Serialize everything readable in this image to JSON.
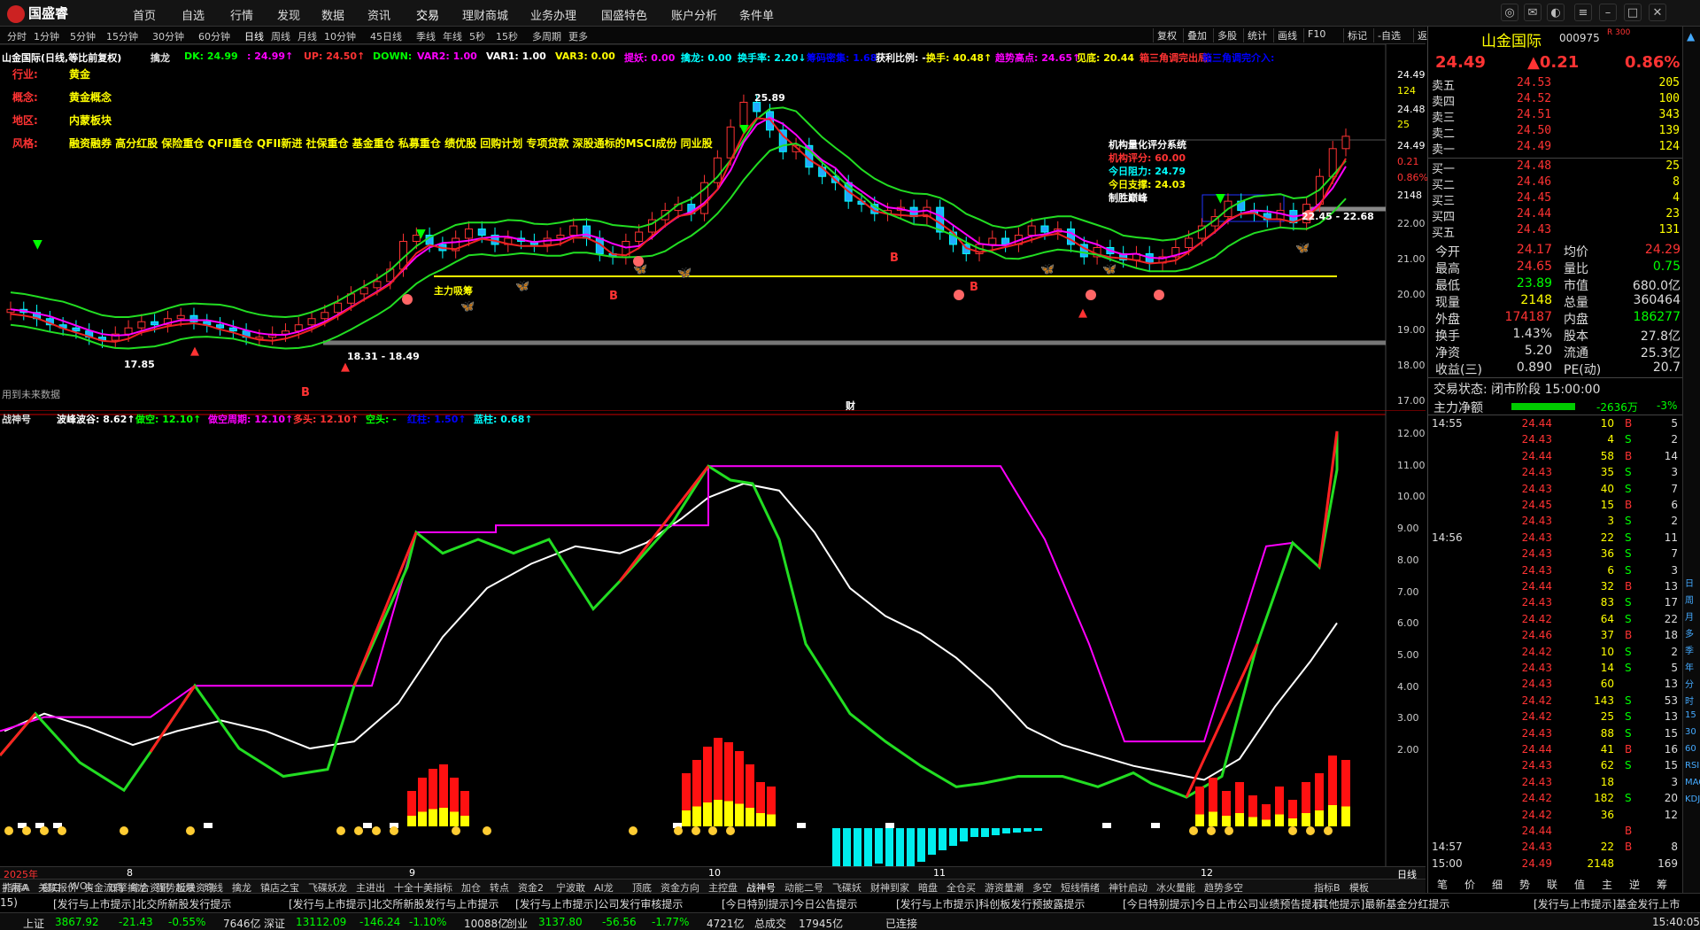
{
  "top": {
    "logo": "国盛睿",
    "nav": [
      "首页",
      "自选",
      "行情",
      "发现",
      "数据",
      "资讯",
      "交易",
      "理财商城",
      "业务办理",
      "国盛特色",
      "账户分析",
      "条件单"
    ]
  },
  "period": {
    "items": [
      "分时",
      "1分钟",
      "5分钟",
      "15分钟",
      "30分钟",
      "60分钟",
      "日线",
      "周线",
      "月线",
      "10分钟",
      "45日线",
      "季线",
      "年线",
      "5秒",
      "15秒",
      "多周期",
      "更多"
    ],
    "selected": "日线",
    "tools": [
      "复权",
      "叠加",
      "多股",
      "统计",
      "画线",
      "F10",
      "标记",
      "-自选",
      "返回"
    ]
  },
  "chart1": {
    "title": "山金国际(日线,等比前复权)",
    "indicator": "擒龙",
    "params": [
      {
        "t": "DK: 24.99",
        "c": "#0f0"
      },
      {
        "t": ": 24.99↑",
        "c": "#f0f"
      },
      {
        "t": "UP: 24.50↑",
        "c": "#f33"
      },
      {
        "t": "DOWN: ",
        "c": "#0f0"
      },
      {
        "t": "VAR2: 1.00",
        "c": "#f0f"
      },
      {
        "t": "VAR1: 1.00",
        "c": "#fff"
      },
      {
        "t": "VAR3: 0.00",
        "c": "#ff0"
      },
      {
        "t": "提妖: 0.00",
        "c": "#f0f"
      },
      {
        "t": "擒龙: 0.00",
        "c": "#0ff"
      },
      {
        "t": "换手率: 2.20↓",
        "c": "#0ff"
      },
      {
        "t": "筹码密集: 1.68",
        "c": "#00f"
      },
      {
        "t": "获利比例: -",
        "c": "#fff"
      },
      {
        "t": "换手: 40.48↑",
        "c": "#ff0"
      },
      {
        "t": "趋势高点: 24.65↑",
        "c": "#f0f"
      },
      {
        "t": "见底: 20.44",
        "c": "#ff0"
      },
      {
        "t": "箱三角调完出局: ",
        "c": "#f33"
      },
      {
        "t": "箱三角调完介入:",
        "c": "#00f"
      }
    ],
    "info": [
      {
        "k": "行业:",
        "v": "黄金"
      },
      {
        "k": "概念:",
        "v": "黄金概念"
      },
      {
        "k": "地区:",
        "v": "内蒙板块"
      },
      {
        "k": "风格:",
        "v": "融资融券 高分红股 保险重仓 QFII重仓 QFII新进 社保重仓 基金重仓 私募重仓 绩优股 回购计划 专项贷款 深股通标的MSCI成份 同业股"
      }
    ],
    "jigou": {
      "title": "机构量化评分系统",
      "score": "机构评分: 60.00",
      "zuli": "今日阻力: 24.79",
      "zhicheng": "今日支撑: 24.03",
      "zhisheng": "制胜巅峰"
    },
    "ann": {
      "zhuli": "主力吸筹",
      "hi": "25.89",
      "lo1": "17.85",
      "lo2": "18.31 - 18.49",
      "range": "22.45 - 22.68",
      "future": "用到未来数据",
      "cai": "财"
    },
    "yaxis": [
      "24.49",
      "124",
      "24.48",
      "25",
      "24.49",
      "0.21",
      "0.86%",
      "2148",
      "22.00",
      "21.00",
      "20.00",
      "19.00",
      "18.00",
      "17.00"
    ]
  },
  "chart2": {
    "title": "战神号",
    "params": [
      {
        "t": "波峰波谷: 8.62↑",
        "c": "#fff"
      },
      {
        "t": "做空: 12.10↑",
        "c": "#0f0"
      },
      {
        "t": "做空周期: 12.10↑",
        "c": "#f0f"
      },
      {
        "t": "多头: 12.10↑",
        "c": "#f33"
      },
      {
        "t": "空头: -",
        "c": "#0f0"
      },
      {
        "t": "红柱: 1.50↑",
        "c": "#00f"
      },
      {
        "t": "蓝柱: 0.68↑",
        "c": "#0ff"
      }
    ],
    "yaxis": [
      "12.00",
      "11.00",
      "10.00",
      "9.00",
      "8.00",
      "7.00",
      "6.00",
      "5.00",
      "4.00",
      "3.00",
      "2.00"
    ]
  },
  "dates": {
    "y2025": "2025年",
    "m": [
      "8",
      "9",
      "10",
      "11",
      "12"
    ],
    "period_label": "日线"
  },
  "bottom_tabs": [
    "指标A",
    "窗口",
    "WOL",
    "双擎擒龙",
    "强势起爆",
    "均线",
    "擒龙",
    "镇店之宝",
    "飞碟妖龙",
    "主进出",
    "十全十美指标",
    "加仓",
    "转点",
    "资金2",
    "宁波敢",
    "AI龙",
    "顶底",
    "资金方向",
    "主控盘",
    "战神号",
    "动能二号",
    "飞碟妖",
    "财神到家",
    "暗盘",
    "全仓买",
    "游资量潮",
    "多空",
    "短线情绪",
    "神针启动",
    "冰火量能",
    "趋势多空"
  ],
  "bottom_tabs2": [
    "扩展A",
    "关联报价",
    "资金流向",
    "综合资讯",
    "板块资讯"
  ],
  "bottom_right": [
    "指标B",
    "模板"
  ],
  "news": [
    {
      "t": "15)",
      "c": "#ddd"
    },
    {
      "t": "[发行与上市提示]北交所新股发行提示",
      "c": "#ddd"
    },
    {
      "t": "[发行与上市提示]北交所新股发行与上市提示",
      "c": "#ddd"
    },
    {
      "t": "[发行与上市提示]公司发行审核提示",
      "c": "#ddd"
    },
    {
      "t": "[今日特别提示]今日公告提示",
      "c": "#ddd"
    },
    {
      "t": "[发行与上市提示]科创板发行预披露提示",
      "c": "#ddd"
    },
    {
      "t": "[今日特别提示]今日上市公司业绩预告提示",
      "c": "#ddd"
    },
    {
      "t": "[其他提示]最新基金分红提示",
      "c": "#ddd"
    },
    {
      "t": "[发行与上市提示]基金发行上市",
      "c": "#ddd"
    }
  ],
  "status": {
    "sh": {
      "n": "上证",
      "p": "3867.92",
      "c": "-21.43",
      "pct": "-0.55%",
      "v": "7646亿"
    },
    "sz": {
      "n": "深证",
      "p": "13112.09",
      "c": "-146.24",
      "pct": "-1.10%",
      "v": "10088亿"
    },
    "cy": {
      "n": "创业",
      "p": "3137.80",
      "c": "-56.56",
      "pct": "-1.77%",
      "v": "4721亿"
    },
    "total": {
      "n": "总成交",
      "v": "17945亿"
    },
    "conn": "已连接",
    "time": "15:40:05"
  },
  "right": {
    "name": "山金国际",
    "code": "000975",
    "tag": "R 300",
    "price": "24.49",
    "chg": "▲0.21",
    "pct": "0.86%",
    "asks": [
      {
        "k": "卖五",
        "p": "24.53",
        "v": "205"
      },
      {
        "k": "卖四",
        "p": "24.52",
        "v": "100"
      },
      {
        "k": "卖三",
        "p": "24.51",
        "v": "343"
      },
      {
        "k": "卖二",
        "p": "24.50",
        "v": "139"
      },
      {
        "k": "卖一",
        "p": "24.49",
        "v": "124"
      }
    ],
    "bids": [
      {
        "k": "买一",
        "p": "24.48",
        "v": "25"
      },
      {
        "k": "买二",
        "p": "24.46",
        "v": "8"
      },
      {
        "k": "买三",
        "p": "24.45",
        "v": "4"
      },
      {
        "k": "买四",
        "p": "24.44",
        "v": "23"
      },
      {
        "k": "买五",
        "p": "24.43",
        "v": "131"
      }
    ],
    "stats": [
      [
        {
          "k": "今开",
          "v": "24.17",
          "c": "#f33"
        },
        {
          "k": "均价",
          "v": "24.29",
          "c": "#f33"
        }
      ],
      [
        {
          "k": "最高",
          "v": "24.65",
          "c": "#f33"
        },
        {
          "k": "量比",
          "v": "0.75",
          "c": "#0f0"
        }
      ],
      [
        {
          "k": "最低",
          "v": "23.89",
          "c": "#0f0"
        },
        {
          "k": "市值",
          "v": "680.0亿",
          "c": "#ddd"
        }
      ],
      [
        {
          "k": "现量",
          "v": "2148",
          "c": "#ff0"
        },
        {
          "k": "总量",
          "v": "360464",
          "c": "#ddd"
        }
      ],
      [
        {
          "k": "外盘",
          "v": "174187",
          "c": "#f33"
        },
        {
          "k": "内盘",
          "v": "186277",
          "c": "#0f0"
        }
      ],
      [
        {
          "k": "换手",
          "v": "1.43%",
          "c": "#ddd"
        },
        {
          "k": "股本",
          "v": "27.8亿",
          "c": "#ddd"
        }
      ],
      [
        {
          "k": "净资",
          "v": "5.20",
          "c": "#ddd"
        },
        {
          "k": "流通",
          "v": "25.3亿",
          "c": "#ddd"
        }
      ],
      [
        {
          "k": "收益(三)",
          "v": "0.890",
          "c": "#ddd"
        },
        {
          "k": "PE(动)",
          "v": "20.7",
          "c": "#ddd"
        }
      ]
    ],
    "state": "交易状态: 闭市阶段 15:00:00",
    "netflow": {
      "k": "主力净额",
      "v": "-2636万",
      "pct": "-3%"
    },
    "ticks": [
      {
        "t": "14:55",
        "p": "24.44",
        "v": "10",
        "d": "B",
        "n": "5"
      },
      {
        "t": "",
        "p": "24.43",
        "v": "4",
        "d": "S",
        "n": "2"
      },
      {
        "t": "",
        "p": "24.44",
        "v": "58",
        "d": "B",
        "n": "14"
      },
      {
        "t": "",
        "p": "24.43",
        "v": "35",
        "d": "S",
        "n": "3"
      },
      {
        "t": "",
        "p": "24.43",
        "v": "40",
        "d": "S",
        "n": "7"
      },
      {
        "t": "",
        "p": "24.45",
        "v": "15",
        "d": "B",
        "n": "6"
      },
      {
        "t": "",
        "p": "24.43",
        "v": "3",
        "d": "S",
        "n": "2"
      },
      {
        "t": "14:56",
        "p": "24.43",
        "v": "22",
        "d": "S",
        "n": "11"
      },
      {
        "t": "",
        "p": "24.43",
        "v": "36",
        "d": "S",
        "n": "7"
      },
      {
        "t": "",
        "p": "24.43",
        "v": "6",
        "d": "S",
        "n": "3"
      },
      {
        "t": "",
        "p": "24.44",
        "v": "32",
        "d": "B",
        "n": "13"
      },
      {
        "t": "",
        "p": "24.43",
        "v": "83",
        "d": "S",
        "n": "17"
      },
      {
        "t": "",
        "p": "24.42",
        "v": "64",
        "d": "S",
        "n": "22"
      },
      {
        "t": "",
        "p": "24.46",
        "v": "37",
        "d": "B",
        "n": "18"
      },
      {
        "t": "",
        "p": "24.42",
        "v": "10",
        "d": "S",
        "n": "2"
      },
      {
        "t": "",
        "p": "24.43",
        "v": "14",
        "d": "S",
        "n": "5"
      },
      {
        "t": "",
        "p": "24.43",
        "v": "60",
        "d": "",
        "n": "13"
      },
      {
        "t": "",
        "p": "24.42",
        "v": "143",
        "d": "S",
        "n": "53"
      },
      {
        "t": "",
        "p": "24.42",
        "v": "25",
        "d": "S",
        "n": "13"
      },
      {
        "t": "",
        "p": "24.43",
        "v": "88",
        "d": "S",
        "n": "15"
      },
      {
        "t": "",
        "p": "24.44",
        "v": "41",
        "d": "B",
        "n": "16"
      },
      {
        "t": "",
        "p": "24.43",
        "v": "62",
        "d": "S",
        "n": "15"
      },
      {
        "t": "",
        "p": "24.43",
        "v": "18",
        "d": "",
        "n": "3"
      },
      {
        "t": "",
        "p": "24.42",
        "v": "182",
        "d": "S",
        "n": "20"
      },
      {
        "t": "",
        "p": "24.42",
        "v": "36",
        "d": "",
        "n": "12"
      },
      {
        "t": "",
        "p": "24.44",
        "v": "",
        "d": "B",
        "n": ""
      },
      {
        "t": "14:57",
        "p": "24.43",
        "v": "22",
        "d": "B",
        "n": "8"
      },
      {
        "t": "15:00",
        "p": "24.49",
        "v": "2148",
        "d": "",
        "n": "169"
      }
    ],
    "bottom": [
      "笔",
      "价",
      "细",
      "势",
      "联",
      "值",
      "主",
      "逆",
      "筹"
    ]
  },
  "sidebar": [
    "日",
    "周",
    "月",
    "多",
    "季",
    "年",
    "分",
    "时",
    "15",
    "30",
    "60",
    "RSI",
    "MACD",
    "KDJ"
  ]
}
